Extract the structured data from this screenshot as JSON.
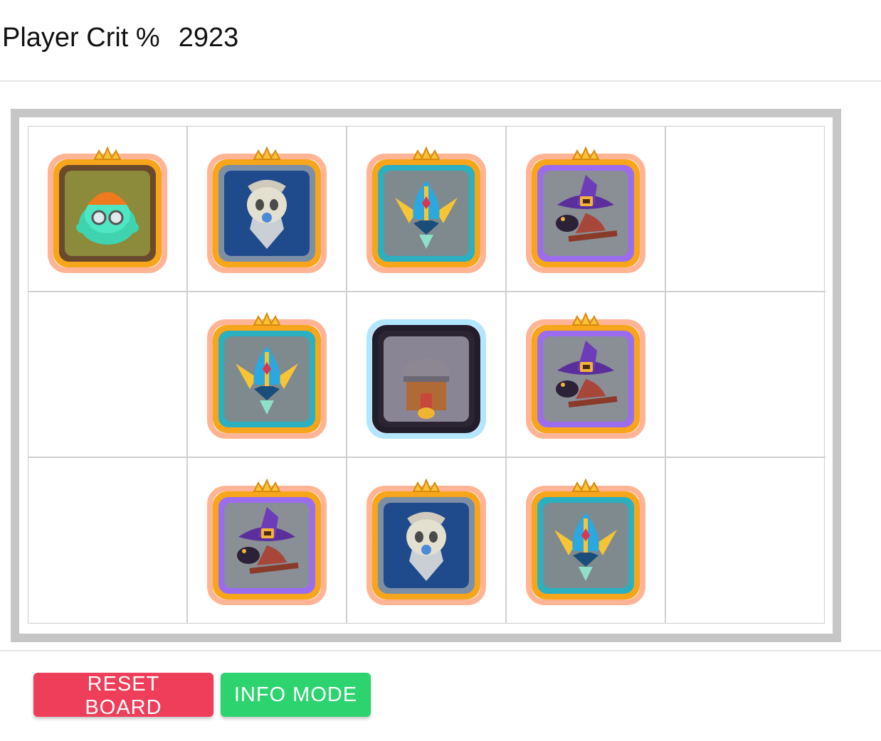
{
  "stat": {
    "label": "Player Crit %",
    "value": "2923"
  },
  "board": {
    "cells": [
      {
        "unit": "slime-miner",
        "frame": "gold"
      },
      {
        "unit": "skull-knight",
        "frame": "gold"
      },
      {
        "unit": "winged-helm",
        "frame": "gold"
      },
      {
        "unit": "witch-crow",
        "frame": "gold"
      },
      {
        "unit": "empty",
        "frame": "none"
      },
      {
        "unit": "empty",
        "frame": "none"
      },
      {
        "unit": "winged-helm",
        "frame": "gold"
      },
      {
        "unit": "anvil-cannon",
        "frame": "dark"
      },
      {
        "unit": "witch-crow",
        "frame": "gold"
      },
      {
        "unit": "empty",
        "frame": "none"
      },
      {
        "unit": "empty",
        "frame": "none"
      },
      {
        "unit": "witch-crow",
        "frame": "gold"
      },
      {
        "unit": "skull-knight",
        "frame": "gold"
      },
      {
        "unit": "winged-helm",
        "frame": "gold"
      },
      {
        "unit": "empty",
        "frame": "none"
      }
    ]
  },
  "buttons": {
    "reset_label": "RESET BOARD",
    "info_label": "INFO MODE"
  },
  "colors": {
    "reset": "#ee3e5a",
    "info": "#2dd36f",
    "frame_gold": "#f7a51a",
    "board_border": "#c6c6c6"
  }
}
